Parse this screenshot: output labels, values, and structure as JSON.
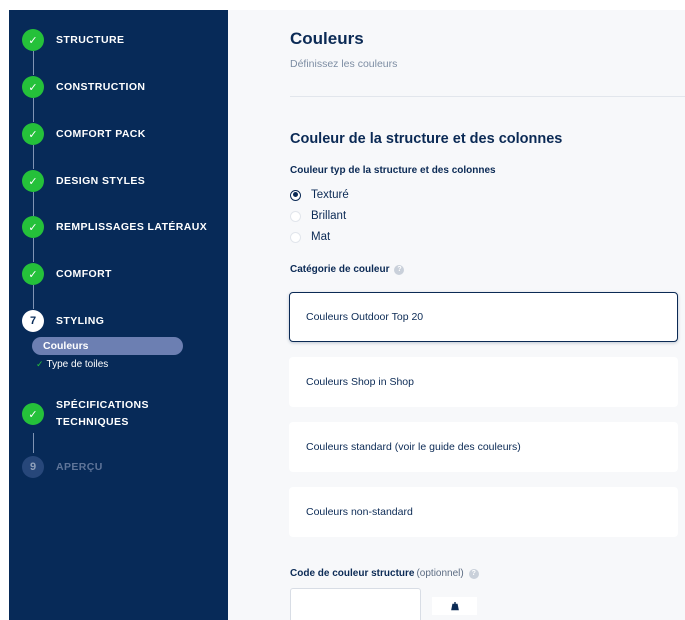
{
  "sidebar": {
    "steps": [
      {
        "number": "1",
        "label": "STRUCTURE",
        "status": "done"
      },
      {
        "number": "2",
        "label": "CONSTRUCTION",
        "status": "done"
      },
      {
        "number": "3",
        "label": "COMFORT PACK",
        "status": "done"
      },
      {
        "number": "4",
        "label": "DESIGN STYLES",
        "status": "done"
      },
      {
        "number": "5",
        "label": "REMPLISSAGES LATÉRAUX",
        "status": "done"
      },
      {
        "number": "6",
        "label": "COMFORT",
        "status": "done"
      },
      {
        "number": "7",
        "label": "STYLING",
        "status": "current"
      },
      {
        "number": "8",
        "label_line1": "SPÉCIFICATIONS",
        "label_line2": "TECHNIQUES",
        "status": "done"
      },
      {
        "number": "9",
        "label": "APERÇU",
        "status": "todo"
      }
    ],
    "substeps": [
      {
        "label": "Couleurs",
        "active": true
      },
      {
        "label": "Type de toiles",
        "done": true,
        "check": "✓"
      }
    ],
    "check_glyph": "✓"
  },
  "header": {
    "title": "Couleurs",
    "subtitle": "Définissez les couleurs"
  },
  "section": {
    "title": "Couleur de la structure et des colonnes",
    "finish_label": "Couleur typ de la structure et des colonnes",
    "finish_options": [
      {
        "label": "Texturé",
        "selected": true
      },
      {
        "label": "Brillant",
        "selected": false
      },
      {
        "label": "Mat",
        "selected": false
      }
    ],
    "category_label": "Catégorie de couleur",
    "help_glyph": "?",
    "categories": [
      {
        "label": "Couleurs Outdoor Top 20",
        "selected": true
      },
      {
        "label": "Couleurs Shop in Shop",
        "selected": false
      },
      {
        "label": "Couleurs standard (voir le guide des couleurs)",
        "selected": false
      },
      {
        "label": "Couleurs non-standard",
        "selected": false
      }
    ],
    "code_label": "Code de couleur structure",
    "code_optional": "(optionnel)",
    "code_value": ""
  },
  "colors": {
    "sidebar_bg": "#072a58",
    "done_green": "#25c13a",
    "active_sub_bg": "#6c7fb2",
    "text_navy": "#0b2a55"
  },
  "icons": {
    "done_step": "check-icon",
    "help": "help-circle-icon",
    "swatch": "paint-bucket-icon"
  }
}
